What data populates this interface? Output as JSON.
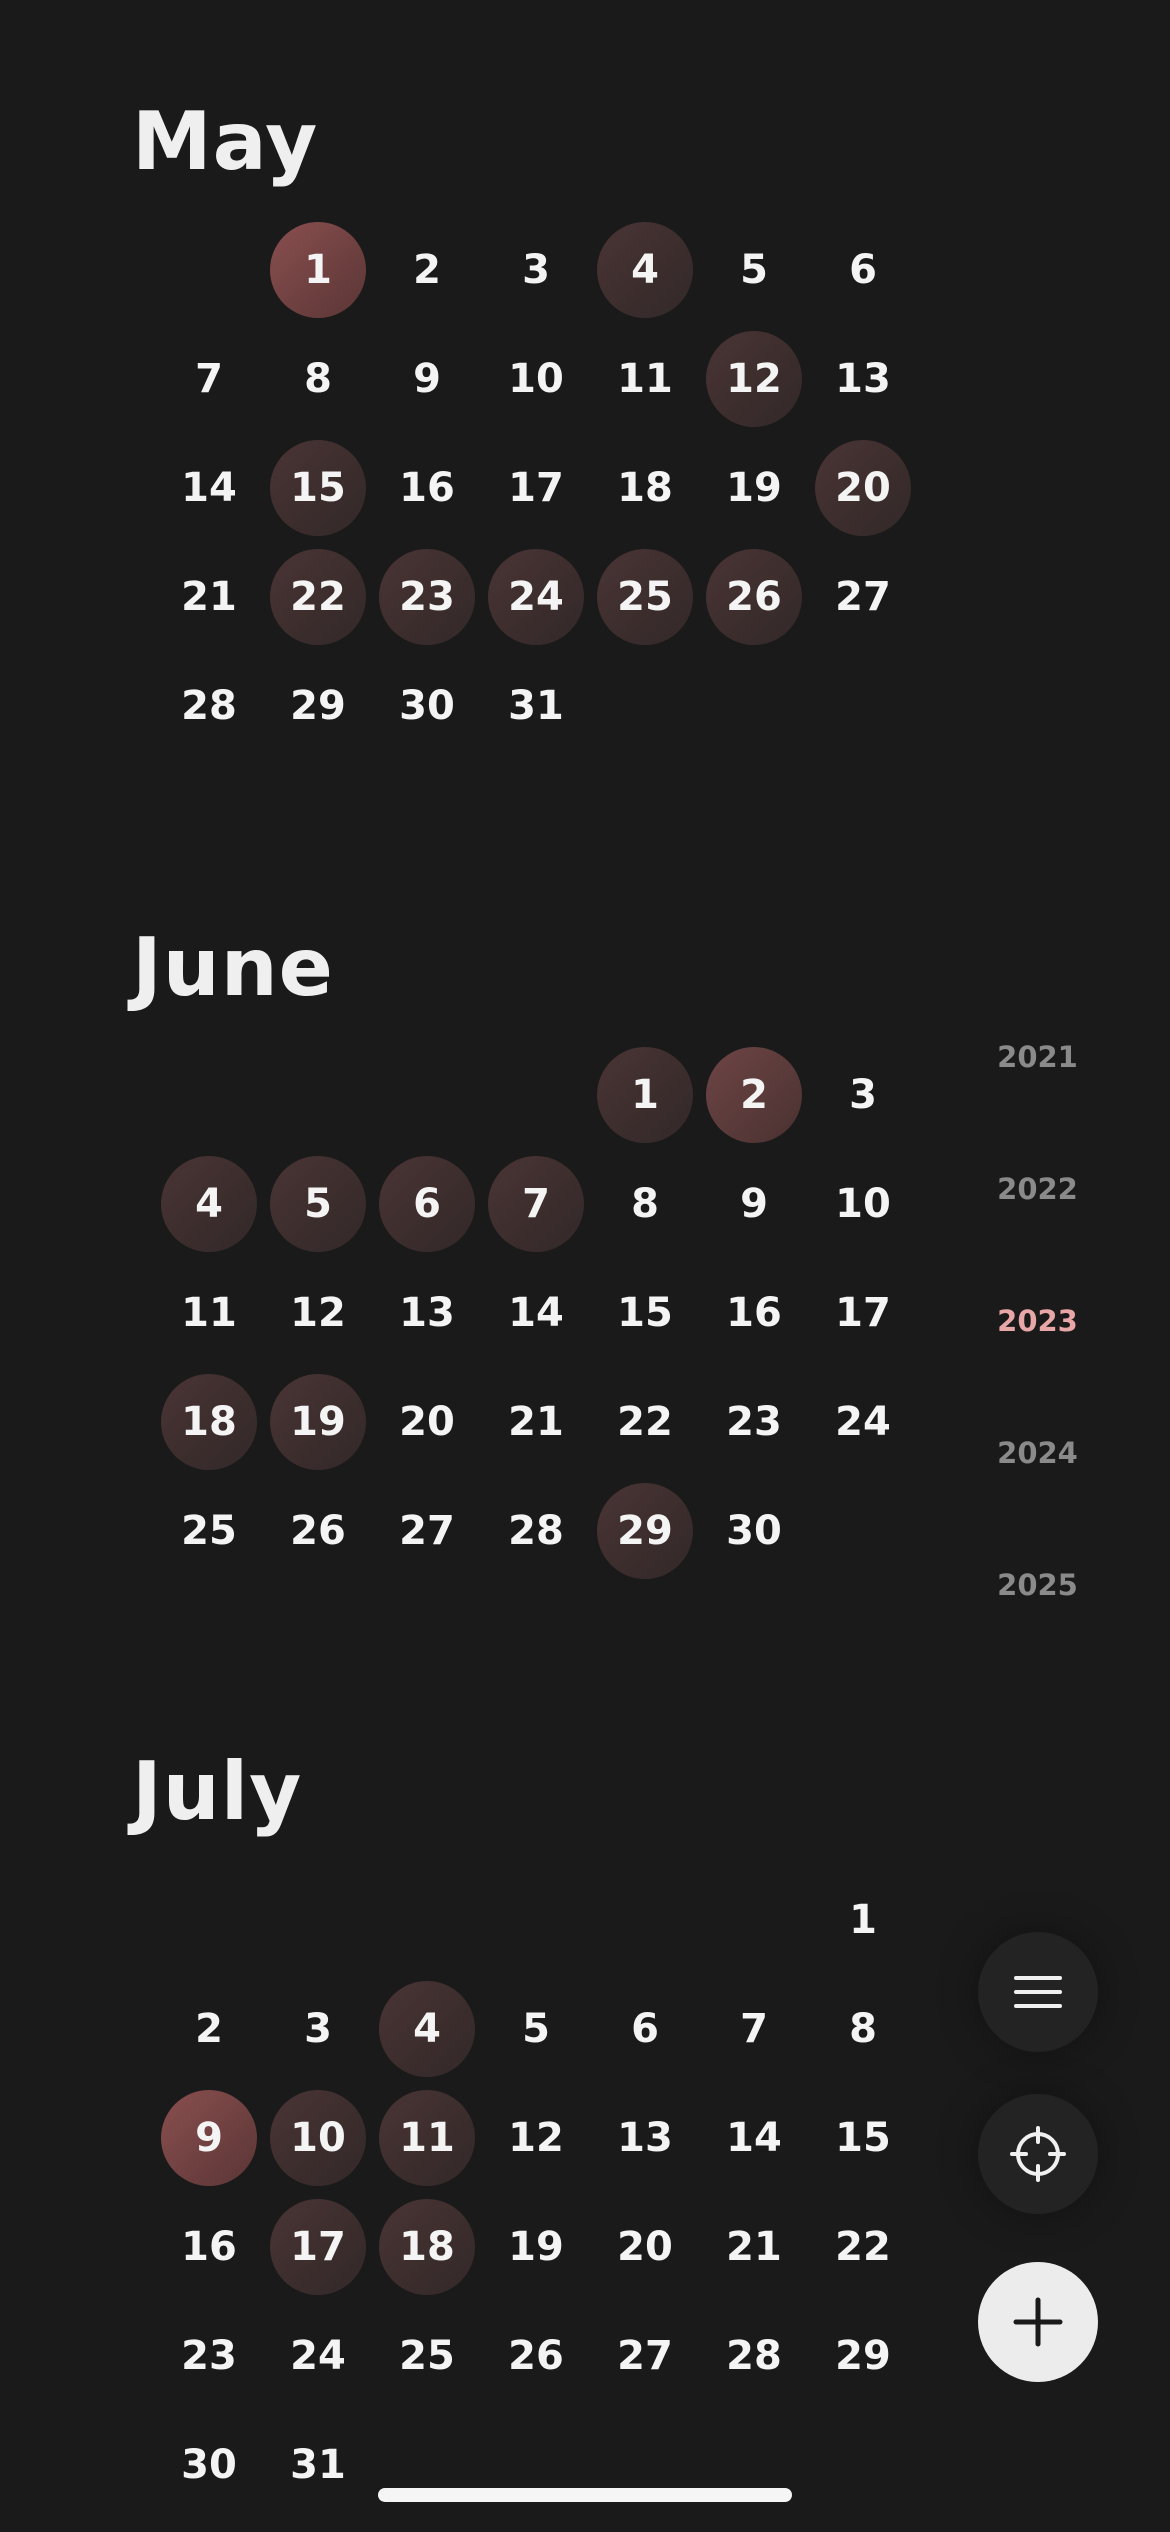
{
  "months": [
    {
      "name": "May",
      "offset": 1,
      "days": 31,
      "marked": {
        "1": 3,
        "4": 1,
        "12": 1,
        "15": 1,
        "20": 1,
        "22": 1,
        "23": 1,
        "24": 1,
        "25": 1,
        "26": 1
      }
    },
    {
      "name": "June",
      "offset": 4,
      "days": 30,
      "marked": {
        "1": 1,
        "2": 2,
        "4": 1,
        "5": 1,
        "6": 1,
        "7": 1,
        "18": 1,
        "19": 1,
        "29": 1
      }
    },
    {
      "name": "July",
      "offset": 6,
      "days": 31,
      "marked": {
        "4": 1,
        "9": 3,
        "10": 1,
        "11": 1,
        "17": 1,
        "18": 1
      }
    }
  ],
  "year_selector": {
    "years": [
      "2021",
      "2022",
      "2023",
      "2024",
      "2025"
    ],
    "active": "2023"
  },
  "actions": {
    "menu_icon": "hamburger-menu-icon",
    "locate_icon": "crosshair-icon",
    "add_icon": "plus-icon"
  },
  "colors": {
    "background": "#1a1a1a",
    "active_year": "#e8a6a6",
    "marked_light": "#4a3434",
    "marked_strong": "#8a4f4f"
  }
}
